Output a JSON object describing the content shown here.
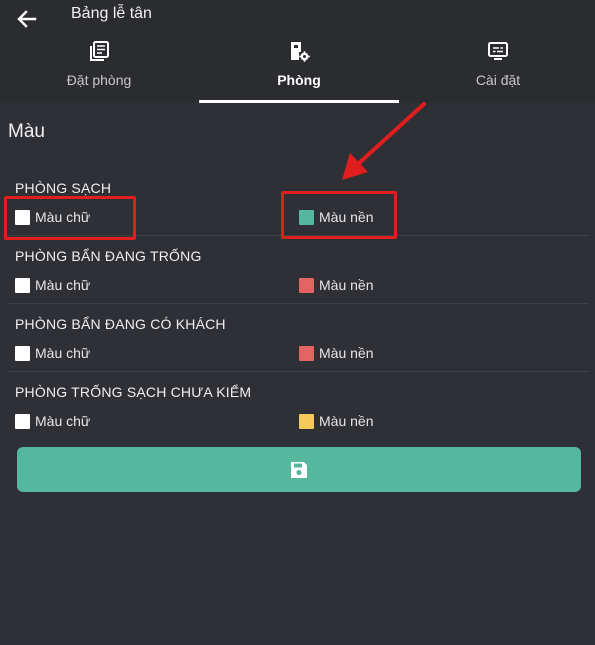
{
  "header": {
    "title": "Bảng lễ tân"
  },
  "tabs": [
    {
      "label": "Đặt phòng",
      "icon": "booking-list-icon"
    },
    {
      "label": "Phòng",
      "icon": "room-settings-icon"
    },
    {
      "label": "Cài đặt",
      "icon": "monitor-settings-icon"
    }
  ],
  "section": {
    "title": "Màu"
  },
  "groups": [
    {
      "title": "PHÒNG SẠCH",
      "text_label": "Màu chữ",
      "text_color": "#ffffff",
      "bg_label": "Màu nền",
      "bg_color": "#55b89c"
    },
    {
      "title": "PHÒNG BẨN ĐANG TRỐNG",
      "text_label": "Màu chữ",
      "text_color": "#ffffff",
      "bg_label": "Màu nền",
      "bg_color": "#e46464"
    },
    {
      "title": "PHÒNG BẨN ĐANG CÓ KHÁCH",
      "text_label": "Màu chữ",
      "text_color": "#ffffff",
      "bg_label": "Màu nền",
      "bg_color": "#e46464"
    },
    {
      "title": "PHÒNG TRỐNG SẠCH CHƯA KIỂM",
      "text_label": "Màu chữ",
      "text_color": "#ffffff",
      "bg_label": "Màu nền",
      "bg_color": "#f7c85a"
    }
  ],
  "save_button": {
    "icon": "save-icon",
    "color": "#55b89c"
  },
  "annotation": {
    "color": "#e01e1e"
  }
}
